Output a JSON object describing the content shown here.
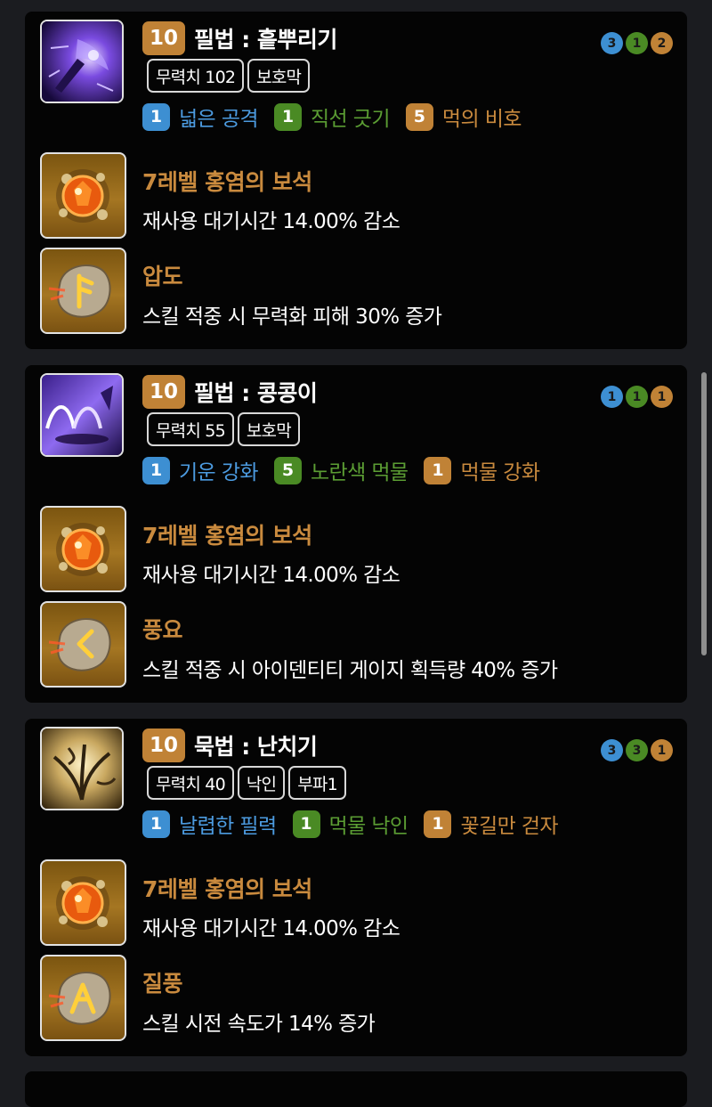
{
  "skills": [
    {
      "level": "10",
      "name": "필법 : 흩뿌리기",
      "icon": "purple-brush-scatter-icon",
      "tags": [
        "무력치 102",
        "보호막"
      ],
      "tier_dots": [
        "3",
        "1",
        "2"
      ],
      "tripods": [
        {
          "level": "1",
          "label": "넓은 공격",
          "tier": "blue"
        },
        {
          "level": "1",
          "label": "직선 긋기",
          "tier": "green"
        },
        {
          "level": "5",
          "label": "먹의 비호",
          "tier": "orange"
        }
      ],
      "gem": {
        "icon": "fire-gem-icon",
        "name": "7레벨 홍염의 보석",
        "desc": "재사용 대기시간 14.00% 감소"
      },
      "rune": {
        "icon": "rune-stone-icon",
        "name": "압도",
        "desc": "스킬 적중 시 무력화 피해 30% 증가"
      }
    },
    {
      "level": "10",
      "name": "필법 : 콩콩이",
      "icon": "purple-hop-icon",
      "tags": [
        "무력치 55",
        "보호막"
      ],
      "tier_dots": [
        "1",
        "1",
        "1"
      ],
      "tripods": [
        {
          "level": "1",
          "label": "기운 강화",
          "tier": "blue"
        },
        {
          "level": "5",
          "label": "노란색 먹물",
          "tier": "green"
        },
        {
          "level": "1",
          "label": "먹물 강화",
          "tier": "orange"
        }
      ],
      "gem": {
        "icon": "fire-gem-icon",
        "name": "7레벨 홍염의 보석",
        "desc": "재사용 대기시간 14.00% 감소"
      },
      "rune": {
        "icon": "rune-stone-icon",
        "name": "풍요",
        "desc": "스킬 적중 시 아이덴티티 게이지 획득량 40% 증가"
      }
    },
    {
      "level": "10",
      "name": "묵법 : 난치기",
      "icon": "golden-orchid-icon",
      "tags": [
        "무력치 40",
        "낙인",
        "부파1"
      ],
      "tier_dots": [
        "3",
        "3",
        "1"
      ],
      "tripods": [
        {
          "level": "1",
          "label": "날렵한 필력",
          "tier": "blue"
        },
        {
          "level": "1",
          "label": "먹물 낙인",
          "tier": "green"
        },
        {
          "level": "1",
          "label": "꽃길만 걷자",
          "tier": "orange"
        }
      ],
      "gem": {
        "icon": "fire-gem-icon",
        "name": "7레벨 홍염의 보석",
        "desc": "재사용 대기시간 14.00% 감소"
      },
      "rune": {
        "icon": "rune-stone-icon",
        "name": "질풍",
        "desc": "스킬 시전 속도가 14% 증가"
      }
    }
  ],
  "colors": {
    "background": "#1b1c20",
    "card": "#040404",
    "tier_blue": "#3d8fd2",
    "tier_green": "#4a8a24",
    "tier_orange": "#c08236",
    "effect_name": "#c98a3e"
  }
}
